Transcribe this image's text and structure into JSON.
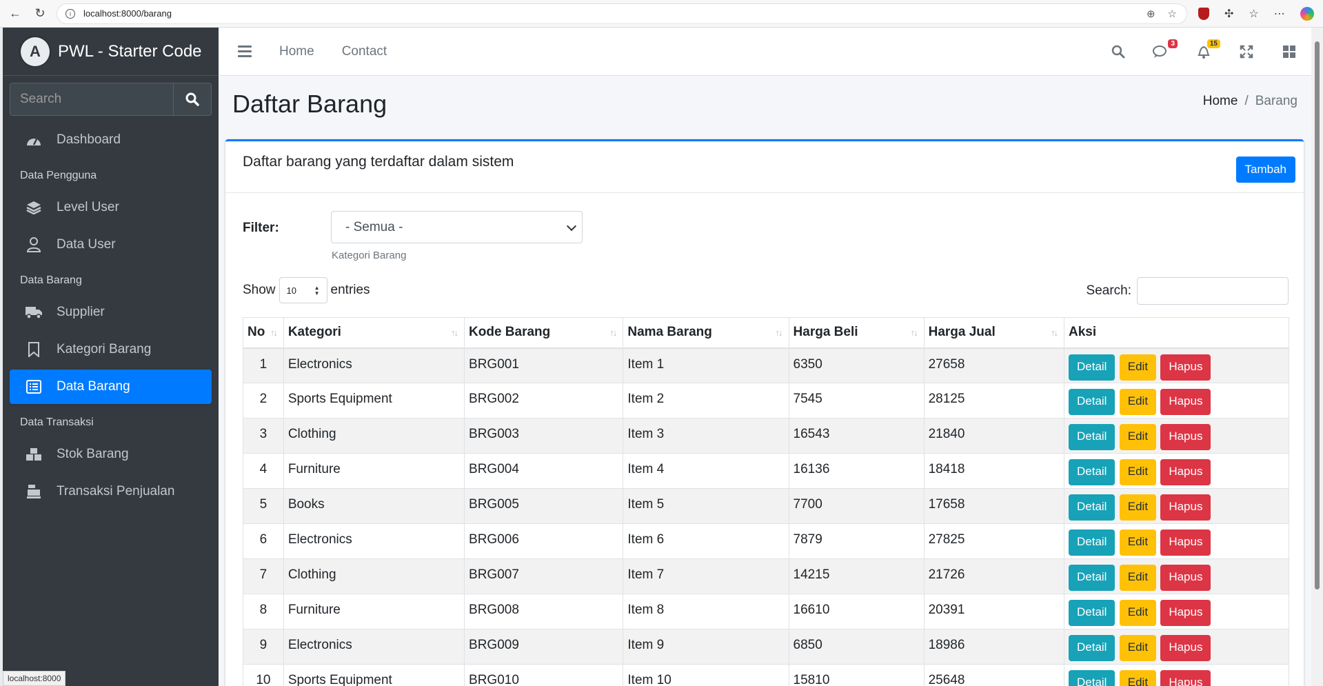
{
  "browser": {
    "url": "localhost:8000/barang",
    "status_tip": "localhost:8000"
  },
  "sidebar": {
    "brand": "PWL - Starter Code",
    "search_placeholder": "Search",
    "items": [
      {
        "type": "item",
        "label": "Dashboard",
        "icon": "dashboard-icon"
      },
      {
        "type": "header",
        "label": "Data Pengguna"
      },
      {
        "type": "item",
        "label": "Level User",
        "icon": "layers-icon"
      },
      {
        "type": "item",
        "label": "Data User",
        "icon": "user-icon"
      },
      {
        "type": "header",
        "label": "Data Barang"
      },
      {
        "type": "item",
        "label": "Supplier",
        "icon": "truck-icon"
      },
      {
        "type": "item",
        "label": "Kategori Barang",
        "icon": "bookmark-icon"
      },
      {
        "type": "item",
        "label": "Data Barang",
        "icon": "list-icon",
        "active": true
      },
      {
        "type": "header",
        "label": "Data Transaksi"
      },
      {
        "type": "item",
        "label": "Stok Barang",
        "icon": "cubes-icon"
      },
      {
        "type": "item",
        "label": "Transaksi Penjualan",
        "icon": "cash-register-icon"
      }
    ]
  },
  "topbar": {
    "links": [
      "Home",
      "Contact"
    ],
    "messages_count": "3",
    "notifications_count": "15"
  },
  "page": {
    "title": "Daftar Barang",
    "breadcrumb": {
      "home": "Home",
      "current": "Barang"
    }
  },
  "card": {
    "title": "Daftar barang yang terdaftar dalam sistem",
    "add_button": "Tambah",
    "filter_label": "Filter:",
    "filter_value": "- Semua -",
    "filter_help": "Kategori Barang",
    "show_label": "Show",
    "entries_value": "10",
    "entries_label": "entries",
    "search_label": "Search:"
  },
  "table": {
    "columns": [
      "No",
      "Kategori",
      "Kode Barang",
      "Nama Barang",
      "Harga Beli",
      "Harga Jual",
      "Aksi"
    ],
    "actions": {
      "detail": "Detail",
      "edit": "Edit",
      "hapus": "Hapus"
    },
    "rows": [
      [
        "1",
        "Electronics",
        "BRG001",
        "Item 1",
        "6350",
        "27658"
      ],
      [
        "2",
        "Sports Equipment",
        "BRG002",
        "Item 2",
        "7545",
        "28125"
      ],
      [
        "3",
        "Clothing",
        "BRG003",
        "Item 3",
        "16543",
        "21840"
      ],
      [
        "4",
        "Furniture",
        "BRG004",
        "Item 4",
        "16136",
        "18418"
      ],
      [
        "5",
        "Books",
        "BRG005",
        "Item 5",
        "7700",
        "17658"
      ],
      [
        "6",
        "Electronics",
        "BRG006",
        "Item 6",
        "7879",
        "27825"
      ],
      [
        "7",
        "Clothing",
        "BRG007",
        "Item 7",
        "14215",
        "21726"
      ],
      [
        "8",
        "Furniture",
        "BRG008",
        "Item 8",
        "16610",
        "20391"
      ],
      [
        "9",
        "Electronics",
        "BRG009",
        "Item 9",
        "6850",
        "18986"
      ],
      [
        "10",
        "Sports Equipment",
        "BRG010",
        "Item 10",
        "15810",
        "25648"
      ]
    ]
  },
  "colors": {
    "primary": "#007bff",
    "info": "#17a2b8",
    "warning": "#ffc107",
    "danger": "#dc3545",
    "sidebar_bg": "#343a40"
  }
}
